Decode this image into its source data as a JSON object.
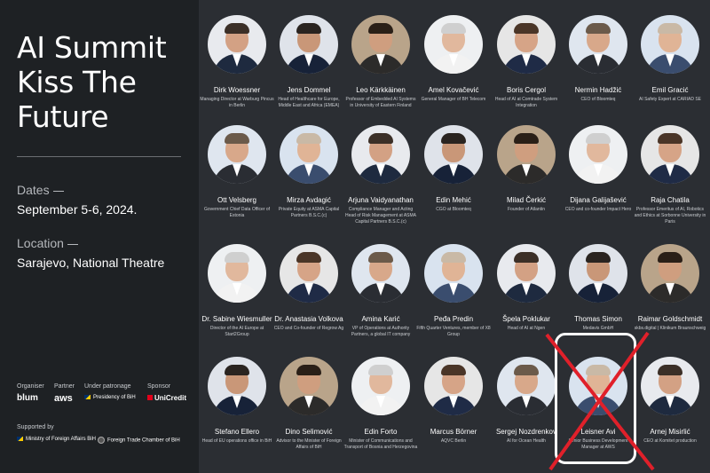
{
  "event": {
    "title_lines": [
      "AI Summit",
      "Kiss The",
      "Future"
    ],
    "dates_label": "Dates",
    "dates_value": "September 5-6, 2024.",
    "location_label": "Location",
    "location_value": "Sarajevo, National Theatre"
  },
  "sponsors": {
    "organiser_label": "Organiser",
    "partner_label": "Partner",
    "patronage_label": "Under patronage",
    "sponsor_label": "Sponsor",
    "organiser": "blum",
    "partner": "aws",
    "patronage": "Presidency of BiH",
    "sponsor": "UniCredit",
    "supported_label": "Supported by",
    "supporters": [
      "Ministry of Foreign Affairs BiH",
      "Foreign Trade Chamber of BiH"
    ]
  },
  "speakers": [
    {
      "name": "Dirk Woessner",
      "role": "Managing Director at Warburg Pincus in Berlin"
    },
    {
      "name": "Jens Dommel",
      "role": "Head of Healthcare for Europe, Middle East and Africa (EMEA)"
    },
    {
      "name": "Leo Kärkkäinen",
      "role": "Professor of Embedded AI Systems in University of Eastern Finland"
    },
    {
      "name": "Amel Kovačević",
      "role": "General Manager of BH Telecom"
    },
    {
      "name": "Boris Cergol",
      "role": "Head of AI at Comtrade System Integration"
    },
    {
      "name": "Nermin Hadžić",
      "role": "CEO of Bloomteq"
    },
    {
      "name": "Emil Gracić",
      "role": "AI Safety Expert at CARIAD SE"
    },
    {
      "name": "Ott Velsberg",
      "role": "Government Chief Data Officer of Estonia"
    },
    {
      "name": "Mirza Avdagić",
      "role": "Private Equity at ASMA Capital Partners B.S.C.(c)"
    },
    {
      "name": "Arjuna Vaidyanathan",
      "role": "Compliance Manager and Acting Head of Risk Management at ASMA Capital Partners B.S.C.(c)"
    },
    {
      "name": "Edin Mehić",
      "role": "CGO at Bloomteq"
    },
    {
      "name": "Milad Čerkić",
      "role": "Founder of Atlantin"
    },
    {
      "name": "Dijana Galijašević",
      "role": "CEO and co-founder Impact Hero"
    },
    {
      "name": "Raja Chatila",
      "role": "Professor Emeritus of AI, Robotics and Ethics at Sorbonne University in Paris"
    },
    {
      "name": "Dr. Sabine Wiesmuller",
      "role": "Director of the AI Europe at Start2Group"
    },
    {
      "name": "Dr. Anastasia Volkova",
      "role": "CEO and Co-founder of Regrow Ag"
    },
    {
      "name": "Amina Karić",
      "role": "VP of Operations at Authority Partners, a global IT company"
    },
    {
      "name": "Peđa Predin",
      "role": "Fifth Quarter Ventures, member of X8 Group"
    },
    {
      "name": "Špela Poklukar",
      "role": "Head of AI at Ngen"
    },
    {
      "name": "Thomas Simon",
      "role": "Medavis GmbH"
    },
    {
      "name": "Raimar Goldschmidt",
      "role": "skbs.digital | Klinikum Braunschweig"
    },
    {
      "name": "Stefano Ellero",
      "role": "Head of EU operations office in BiH"
    },
    {
      "name": "Dino Selimović",
      "role": "Advisor to the Minister of Foreign Affairs of BiH"
    },
    {
      "name": "Edin Forto",
      "role": "Minister of Communications and Transport of Bosnia and Herzegovina"
    },
    {
      "name": "Marcus Börner",
      "role": "AQVC Berlin"
    },
    {
      "name": "Sergej Nozdrenkov",
      "role": "AI for Ocean Health"
    },
    {
      "name": "Leisner Avi",
      "role": "Senior Business Development Manager at AWS"
    },
    {
      "name": "Arnej Misirlić",
      "role": "CEO at Komitet production"
    }
  ],
  "colors": {
    "background": "#2b2e33",
    "sidebar": "#1e2124",
    "cross": "#e0202a"
  }
}
